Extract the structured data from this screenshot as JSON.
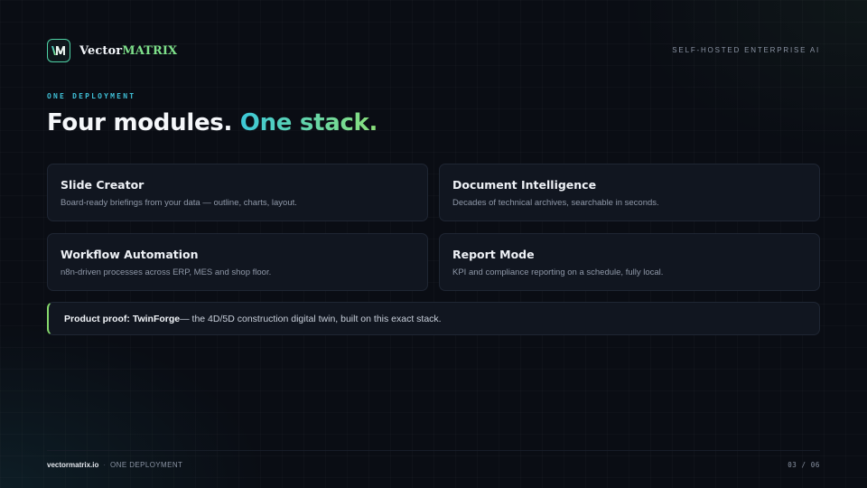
{
  "header": {
    "brand_prefix": "Vector",
    "brand_accent": "MATRIX",
    "logo_icon": "vm-logo-icon",
    "tagline": "SELF-HOSTED ENTERPRISE AI"
  },
  "title": {
    "eyebrow": "ONE DEPLOYMENT",
    "headline_plain": "Four modules.",
    "headline_accent": "One stack."
  },
  "modules": [
    {
      "title": "Slide Creator",
      "description": "Board-ready briefings from your data — outline, charts, layout."
    },
    {
      "title": "Document Intelligence",
      "description": "Decades of technical archives, searchable in seconds."
    },
    {
      "title": "Workflow Automation",
      "description": "n8n-driven processes across ERP, MES and shop floor."
    },
    {
      "title": "Report Mode",
      "description": "KPI and compliance reporting on a schedule, fully local."
    }
  ],
  "proof": {
    "label": "Product proof: TwinForge",
    "text": " — the 4D/5D construction digital twin, built on this exact stack."
  },
  "footer": {
    "site": "vectormatrix.io",
    "separator": "·",
    "section": "ONE DEPLOYMENT",
    "page": "03 / 06"
  },
  "colors": {
    "background": "#0a0d14",
    "card": "#111620",
    "accent_teal": "#3cc8d8",
    "accent_green": "#8be07a"
  }
}
